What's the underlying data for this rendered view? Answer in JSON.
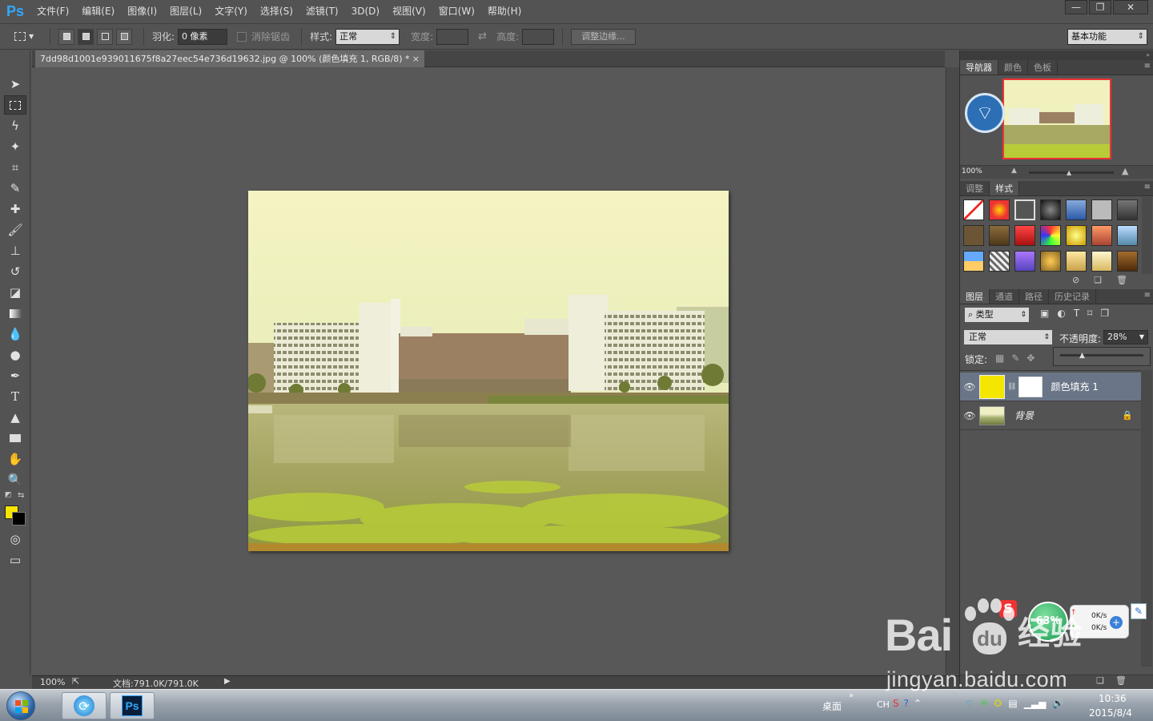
{
  "app": {
    "logo": "Ps"
  },
  "menu": [
    "文件(F)",
    "编辑(E)",
    "图像(I)",
    "图层(L)",
    "文字(Y)",
    "选择(S)",
    "滤镜(T)",
    "3D(D)",
    "视图(V)",
    "窗口(W)",
    "帮助(H)"
  ],
  "options": {
    "feather_label": "羽化:",
    "feather_value": "0 像素",
    "antialias_label": "消除锯齿",
    "style_label": "样式:",
    "style_value": "正常",
    "width_label": "宽度:",
    "height_label": "高度:",
    "refine_edge": "调整边缘...",
    "workspace": "基本功能"
  },
  "document": {
    "tab_title": "7dd98d1001e939011675f8a27eec54e736d19632.jpg @ 100% (颜色填充 1, RGB/8) *",
    "close": "×"
  },
  "status": {
    "zoom": "100%",
    "doc_size": "文档:791.0K/791.0K"
  },
  "navigator": {
    "tabs": [
      "导航器",
      "颜色",
      "色板"
    ],
    "zoom": "100%"
  },
  "adjust_tabs": [
    "调整",
    "样式"
  ],
  "layers": {
    "tabs": [
      "图层",
      "通道",
      "路径",
      "历史记录"
    ],
    "filter": "类型",
    "blend_mode": "正常",
    "opacity_label": "不透明度:",
    "opacity_value": "28%",
    "lock_label": "锁定:",
    "items": [
      {
        "name": "颜色填充 1"
      },
      {
        "name": "背景"
      }
    ]
  },
  "colors": {
    "foreground": "#f5e600",
    "background": "#000000",
    "accent": "#31a8ff"
  },
  "taskbar": {
    "desktop_label": "桌面",
    "lang": "CH",
    "time": "10:36",
    "date": "2015/8/4"
  },
  "network_widget": {
    "percent": "63%",
    "up": "0K/s",
    "down": "0K/s"
  },
  "watermark": {
    "brand": "Bai",
    "brand2": "经验",
    "url": "jingyan.baidu.com"
  }
}
